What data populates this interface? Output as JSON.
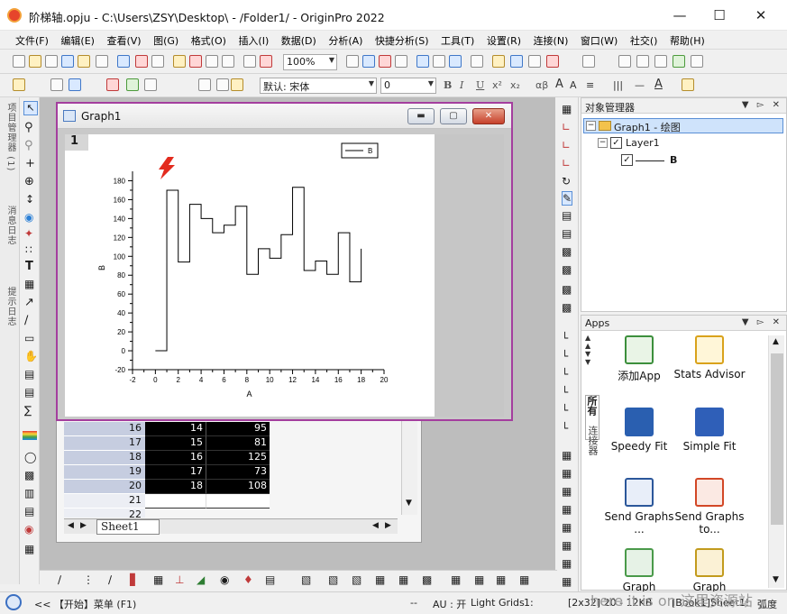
{
  "window": {
    "title": "阶梯轴.opju - C:\\Users\\ZSY\\Desktop\\ - /Folder1/ - OriginPro 2022"
  },
  "menu": [
    "文件(F)",
    "编辑(E)",
    "查看(V)",
    "图(G)",
    "格式(O)",
    "插入(I)",
    "数据(D)",
    "分析(A)",
    "快捷分析(S)",
    "工具(T)",
    "设置(R)",
    "连接(N)",
    "窗口(W)",
    "社交()",
    "帮助(H)"
  ],
  "toolbar": {
    "zoom": "100%",
    "font": "默认: 宋体",
    "font_size": "0"
  },
  "left_tabs": [
    "项目管理器 (1)",
    "消息日志",
    "提示日志"
  ],
  "graph_window": {
    "title": "Graph1",
    "layer": "1"
  },
  "chart_data": {
    "type": "line",
    "subtype": "step",
    "xlabel": "A",
    "ylabel": "B",
    "xlim": [
      -2,
      20
    ],
    "ylim": [
      -20,
      190
    ],
    "xticks": [
      -2,
      0,
      2,
      4,
      6,
      8,
      10,
      12,
      14,
      16,
      18,
      20
    ],
    "yticks": [
      -20,
      0,
      20,
      40,
      60,
      80,
      100,
      120,
      140,
      160,
      180
    ],
    "legend": "top-right",
    "series": [
      {
        "name": "B",
        "x": [
          0,
          1,
          2,
          3,
          4,
          5,
          6,
          7,
          8,
          9,
          10,
          11,
          12,
          13,
          14,
          15,
          16,
          17,
          18
        ],
        "y": [
          0,
          170,
          94,
          155,
          140,
          125,
          133,
          153,
          81,
          108,
          98,
          123,
          173,
          85,
          95,
          81,
          125,
          73,
          108
        ]
      }
    ]
  },
  "worksheet": {
    "rows": [
      {
        "row": "16",
        "a": "14",
        "b": "95"
      },
      {
        "row": "17",
        "a": "15",
        "b": "81"
      },
      {
        "row": "18",
        "a": "16",
        "b": "125"
      },
      {
        "row": "19",
        "a": "17",
        "b": "73"
      },
      {
        "row": "20",
        "a": "18",
        "b": "108"
      },
      {
        "row": "21",
        "a": "",
        "b": ""
      },
      {
        "row": "22",
        "a": "",
        "b": ""
      }
    ],
    "sheet_tab": "Sheet1"
  },
  "object_manager": {
    "title": "对象管理器",
    "graph_node": "Graph1 - 绘图",
    "layer_node": "Layer1",
    "series_node": "B"
  },
  "apps": {
    "title": "Apps",
    "side_tabs": [
      "所有",
      "连接器"
    ],
    "items": [
      {
        "label": "添加App",
        "icon": "add-app-icon",
        "color": "#3c8f3c"
      },
      {
        "label": "Stats Advisor",
        "icon": "magic-wand-icon",
        "color": "#d9a21b"
      },
      {
        "label": "Speedy Fit",
        "icon": "speedy-fit-icon",
        "color": "#2a5fb0"
      },
      {
        "label": "Simple Fit",
        "icon": "simple-fit-icon",
        "color": "#2f5fb8"
      },
      {
        "label": "Send Graphs ...",
        "icon": "word-icon",
        "color": "#2b579a"
      },
      {
        "label": "Send Graphs to...",
        "icon": "powerpoint-icon",
        "color": "#d24726"
      },
      {
        "label": "Graph",
        "icon": "graph-app-icon",
        "color": "#4a9a4a"
      },
      {
        "label": "Graph",
        "icon": "graph-tools-icon",
        "color": "#c29b1d"
      }
    ]
  },
  "status": {
    "left": "<< 【开始】菜单 (F1)",
    "dash": "--",
    "au": "AU : 开",
    "grids": "Light Grids",
    "one": "1:",
    "info": "[2x32] 20 - 12KB",
    "book": "[Book1]Sheet1!",
    "angle": "弧度"
  },
  "watermark": "here it is on 这里资源站"
}
